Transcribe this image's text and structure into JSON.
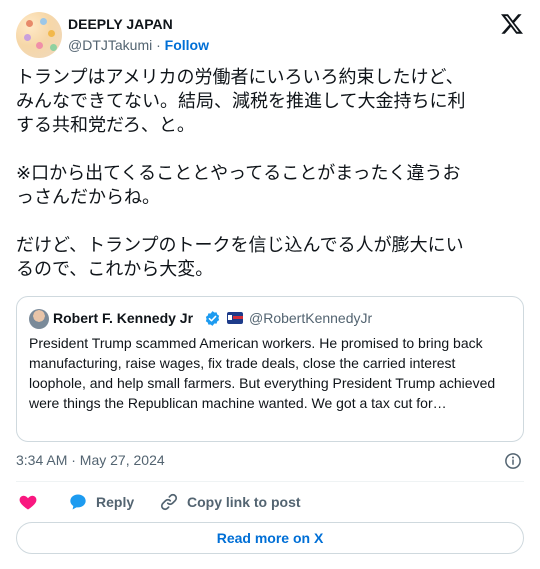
{
  "author": {
    "name": "DEEPLY JAPAN",
    "handle": "@DTJTakumi",
    "separator": "·",
    "follow_label": "Follow"
  },
  "tweet": {
    "text": "トランプはアメリカの労働者にいろいろ約束したけど、\nみんなできてない。結局、減税を推進して大金持ちに利\nする共和党だろ、と。\n\n※口から出てくることとやってることがまったく違うお\nっさんだからね。\n\nだけど、トランプのトークを信じ込んでる人が膨大にい\nるので、これから大変。"
  },
  "quote": {
    "name": "Robert F. Kennedy Jr",
    "handle": "@RobertKennedyJr",
    "text": "President Trump scammed American workers. He promised to bring back manufacturing, raise wages, fix trade deals, close the carried interest loophole, and help small farmers. But everything President Trump achieved were things the Republican machine wanted. We got a tax cut for…"
  },
  "meta": {
    "timestamp": "3:34 AM · May 27, 2024"
  },
  "actions": {
    "reply_label": "Reply",
    "copy_label": "Copy link to post",
    "read_more_label": "Read more on X"
  },
  "colors": {
    "accent": "#006fd6",
    "like": "#f91880",
    "reply": "#1d9bf0",
    "verified": "#1d9bf0"
  },
  "icons": [
    "x-logo-icon",
    "verified-badge-icon",
    "flag-icon",
    "info-icon",
    "heart-icon",
    "reply-bubble-icon",
    "link-icon"
  ]
}
